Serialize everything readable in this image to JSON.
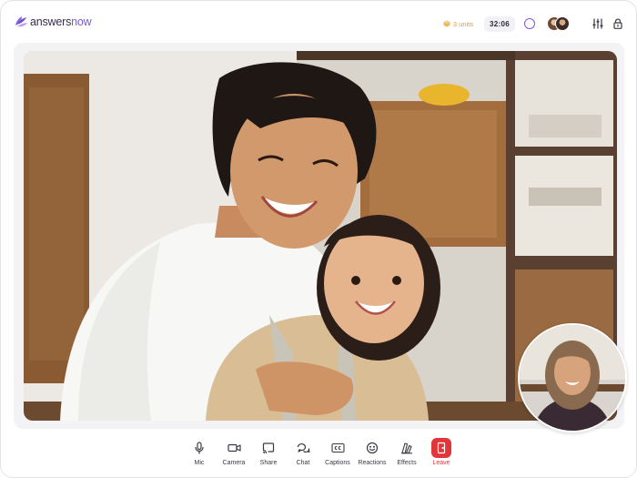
{
  "brand": {
    "name_part1": "answers",
    "name_part2": "now",
    "accent_color": "#7b5bd6"
  },
  "header": {
    "units_label": "3 units",
    "units_color": "#e29a3a",
    "timer": "32:06",
    "icons": [
      "status-ring-icon",
      "participants-avatars",
      "settings-sliders-icon",
      "lock-icon"
    ]
  },
  "video": {
    "main_participant": "main-video-feed",
    "pip_participant": "self-view-feed"
  },
  "controls": [
    {
      "id": "mic",
      "label": "Mic",
      "icon": "mic-icon"
    },
    {
      "id": "camera",
      "label": "Camera",
      "icon": "camera-icon"
    },
    {
      "id": "share",
      "label": "Share",
      "icon": "share-screen-icon"
    },
    {
      "id": "chat",
      "label": "Chat",
      "icon": "chat-icon"
    },
    {
      "id": "captions",
      "label": "Captions",
      "icon": "captions-icon"
    },
    {
      "id": "reactions",
      "label": "Reactions",
      "icon": "reactions-icon"
    },
    {
      "id": "effects",
      "label": "Effects",
      "icon": "effects-icon"
    },
    {
      "id": "leave",
      "label": "Leave",
      "icon": "leave-door-icon",
      "color": "#e2373a"
    }
  ]
}
